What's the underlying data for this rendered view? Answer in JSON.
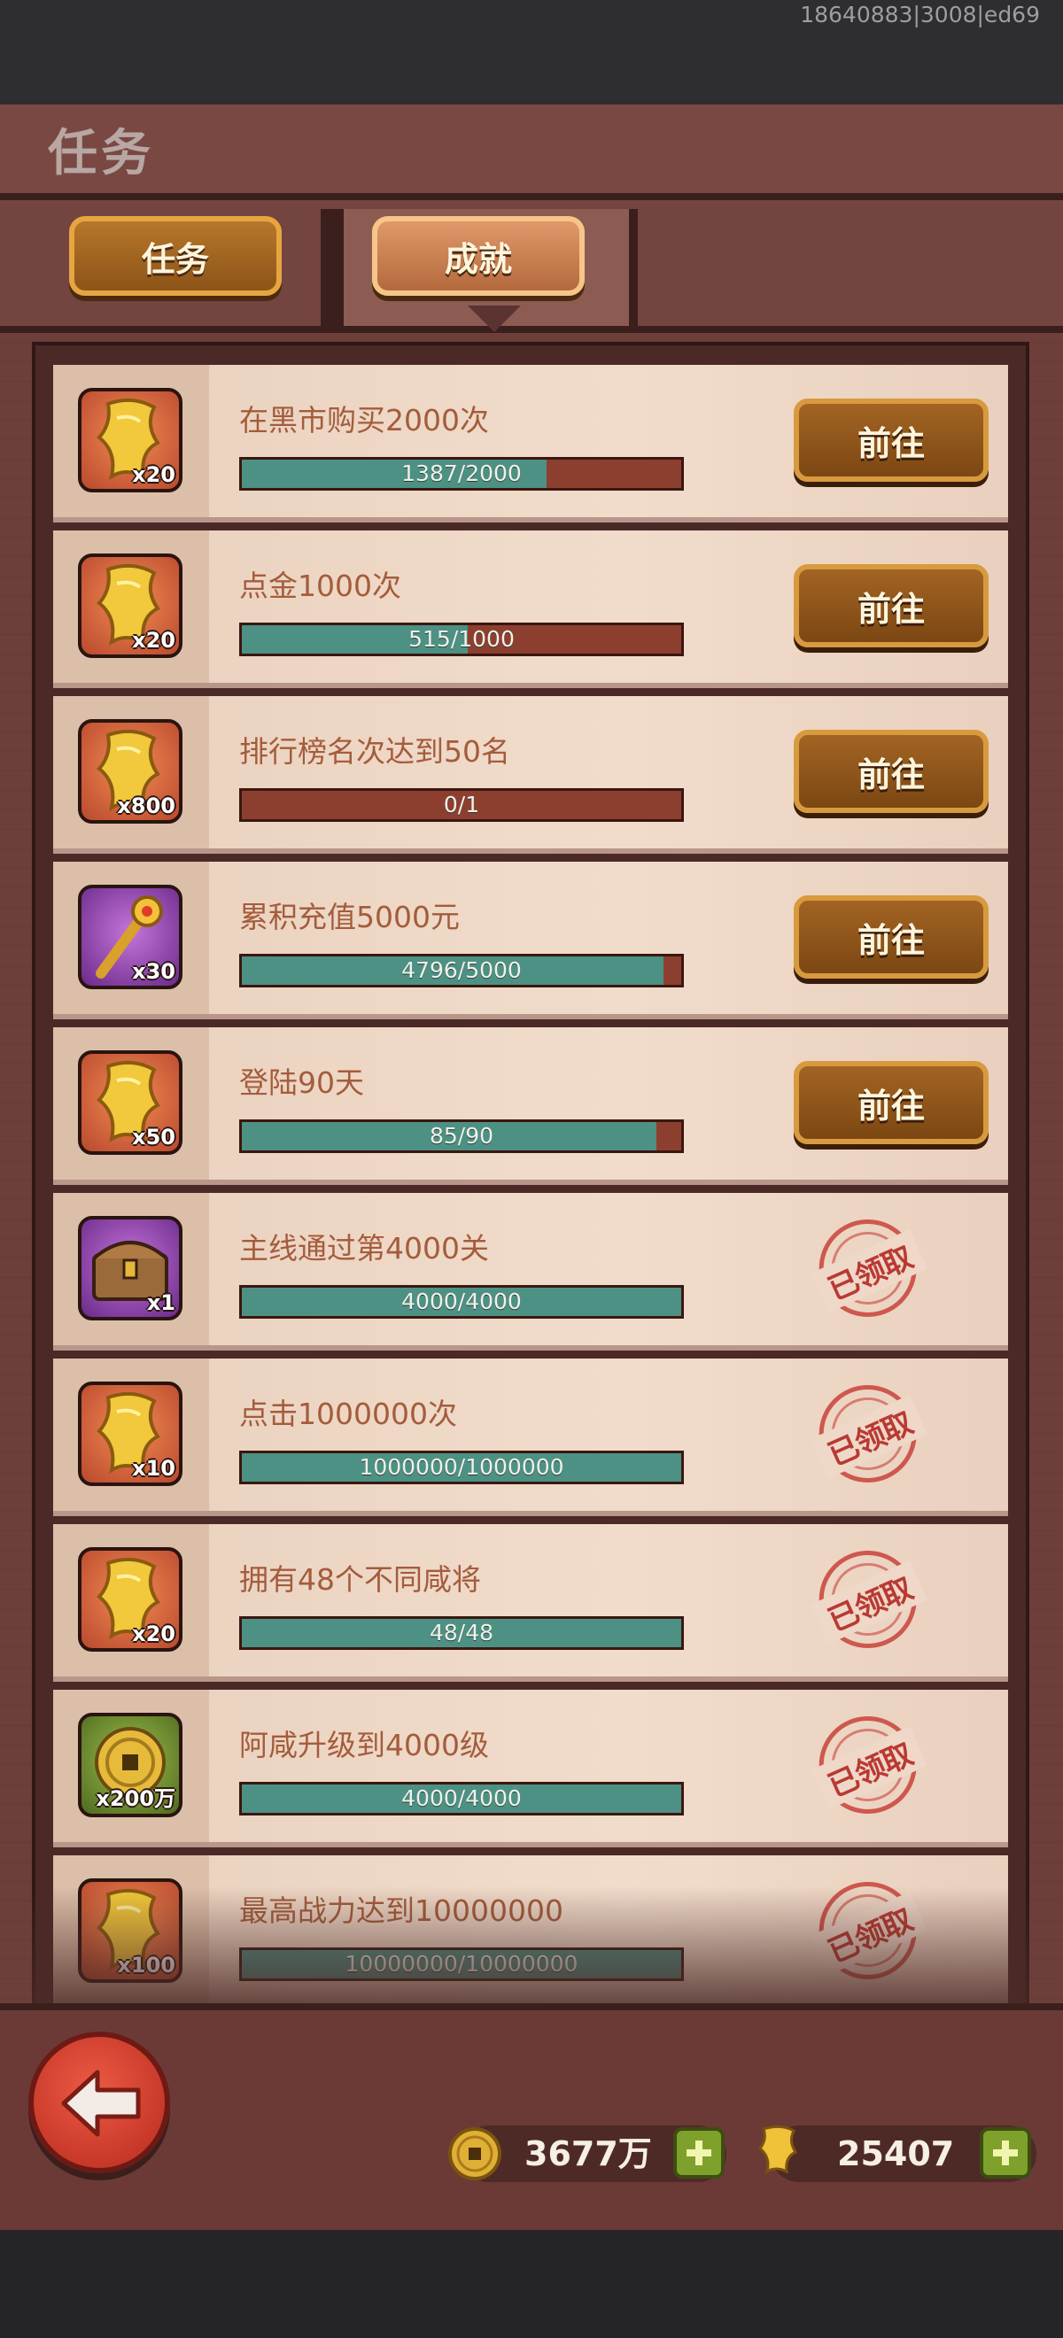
{
  "debug_id": "18640883|3008|ed69",
  "page_title": "任务",
  "tabs": {
    "task": "任务",
    "achievement": "成就"
  },
  "go_label": "前往",
  "claimed_label": "已领取",
  "achievements": [
    {
      "title": "在黑市购买2000次",
      "progress": "1387/2000",
      "ratio": 0.6935,
      "reward": "x20",
      "icon": "gold-scroll-icon",
      "frame": "orange",
      "status": "go"
    },
    {
      "title": "点金1000次",
      "progress": "515/1000",
      "ratio": 0.515,
      "reward": "x20",
      "icon": "gold-scroll-icon",
      "frame": "orange",
      "status": "go"
    },
    {
      "title": "排行榜名次达到50名",
      "progress": "0/1",
      "ratio": 0,
      "reward": "x800",
      "icon": "gold-scroll-icon",
      "frame": "orange",
      "status": "go"
    },
    {
      "title": "累积充值5000元",
      "progress": "4796/5000",
      "ratio": 0.9592,
      "reward": "x30",
      "icon": "golden-staff-icon",
      "frame": "purple",
      "status": "go"
    },
    {
      "title": "登陆90天",
      "progress": "85/90",
      "ratio": 0.9444,
      "reward": "x50",
      "icon": "gold-scroll-icon",
      "frame": "orange",
      "status": "go"
    },
    {
      "title": "主线通过第4000关",
      "progress": "4000/4000",
      "ratio": 1,
      "reward": "x1",
      "icon": "treasure-chest-icon",
      "frame": "purple",
      "status": "claimed"
    },
    {
      "title": "点击1000000次",
      "progress": "1000000/1000000",
      "ratio": 1,
      "reward": "x10",
      "icon": "gold-scroll-icon",
      "frame": "orange",
      "status": "claimed"
    },
    {
      "title": "拥有48个不同咸将",
      "progress": "48/48",
      "ratio": 1,
      "reward": "x20",
      "icon": "gold-scroll-icon",
      "frame": "orange",
      "status": "claimed"
    },
    {
      "title": "阿咸升级到4000级",
      "progress": "4000/4000",
      "ratio": 1,
      "reward": "x200万",
      "icon": "gold-coin-icon",
      "frame": "green",
      "status": "claimed"
    },
    {
      "title": "最高战力达到10000000",
      "progress": "10000000/10000000",
      "ratio": 1,
      "reward": "x100",
      "icon": "gold-scroll-icon",
      "frame": "orange",
      "status": "claimed"
    }
  ],
  "currency": {
    "coins": {
      "value": "3677万",
      "icon": "gold-coin-icon"
    },
    "scrolls": {
      "value": "25407",
      "icon": "gold-scroll-icon"
    }
  },
  "colors": {
    "progress_fill": "#4c9184",
    "progress_track": "#8d3f2f",
    "title_text": "#a45c3c",
    "stamp": "#c8423a"
  }
}
